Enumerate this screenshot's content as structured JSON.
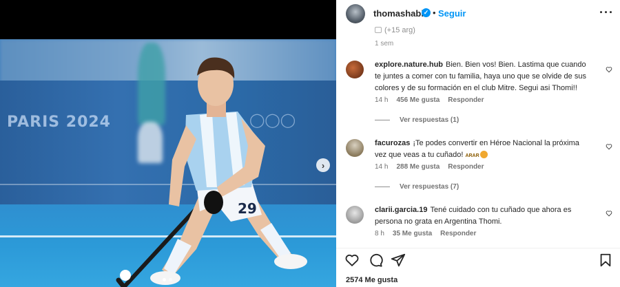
{
  "post": {
    "header": {
      "username": "thomashabif",
      "follow_label": "Seguir",
      "separator": "•",
      "more_label": "···"
    },
    "caption_partial": "(+15 arg)",
    "caption_time": "1 sem",
    "media": {
      "background_signs": [
        "PARIS 2024"
      ],
      "carousel_dots": 2,
      "active_dot": 0
    },
    "comments": [
      {
        "username": "explore.nature.hub",
        "text": "Bien. Bien vos! Bien. Lastima que cuando te juntes a comer con tu familia, haya uno que se olvide de sus colores y de su formación en el club Mitre. Segui asi Thomi!!",
        "time": "14 h",
        "likes": "456 Me gusta",
        "reply_label": "Responder",
        "view_replies": "Ver respuestas (1)",
        "avatar_color": "#7a3a1c"
      },
      {
        "username": "facurozas",
        "text": "¡Te podes convertir en Héroe Nacional la próxima vez que veas a tu cuñado!",
        "emoji_text": "ARAR",
        "time": "14 h",
        "likes": "288 Me gusta",
        "reply_label": "Responder",
        "view_replies": "Ver respuestas (7)",
        "avatar_color": "#8a7a5c"
      },
      {
        "username": "clarii.garcia.19",
        "text": "Tené cuidado con tu cuñado que ahora es persona no grata en Argentina Thomi.",
        "time": "8 h",
        "likes": "35 Me gusta",
        "reply_label": "Responder",
        "avatar_color": "#9a9a9a"
      }
    ],
    "likes_total": "2574 Me gusta",
    "icons": {
      "like": "heart-icon",
      "comment": "comment-icon",
      "share": "share-icon",
      "save": "bookmark-icon",
      "verified": "verified-badge-icon",
      "next": "chevron-right-icon"
    },
    "colors": {
      "link_blue": "#0095f6",
      "text_primary": "#262626",
      "text_secondary": "#737373"
    }
  }
}
